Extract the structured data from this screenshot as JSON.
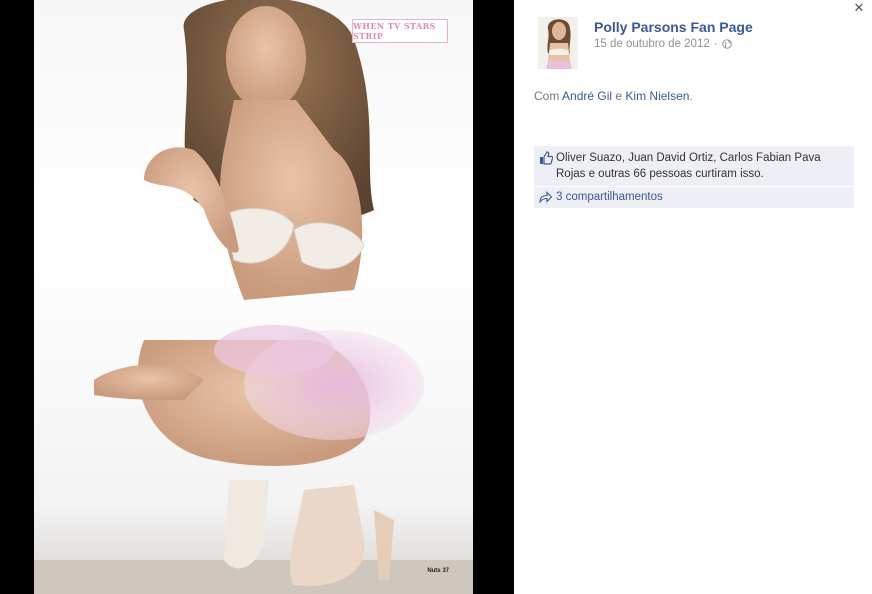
{
  "photo": {
    "magazine_tag": "WHEN TV STARS STRIP",
    "page_number": "Nuts 37"
  },
  "post": {
    "page_name": "Polly Parsons Fan Page",
    "date": "15 de outubro de 2012",
    "date_separator": "·",
    "with_prefix": "Com",
    "tagged": [
      "André Gil",
      "Kim Nielsen"
    ],
    "tag_joiner": "e",
    "tag_end": "."
  },
  "likes": {
    "text": "Oliver Suazo, Juan David Ortiz, Carlos Fabian Pava Rojas e outras 66 pessoas curtiram isso."
  },
  "shares": {
    "label": "3 compartilhamentos"
  },
  "controls": {
    "close_glyph": "✕"
  },
  "icons": {
    "like": "thumbs-up-icon",
    "share": "share-arrow-icon",
    "privacy": "globe-icon",
    "close": "close-icon"
  },
  "colors": {
    "link": "#3b5998",
    "meta": "#909090",
    "likes_bg": "#edeff4",
    "stage_bg": "#000000"
  }
}
